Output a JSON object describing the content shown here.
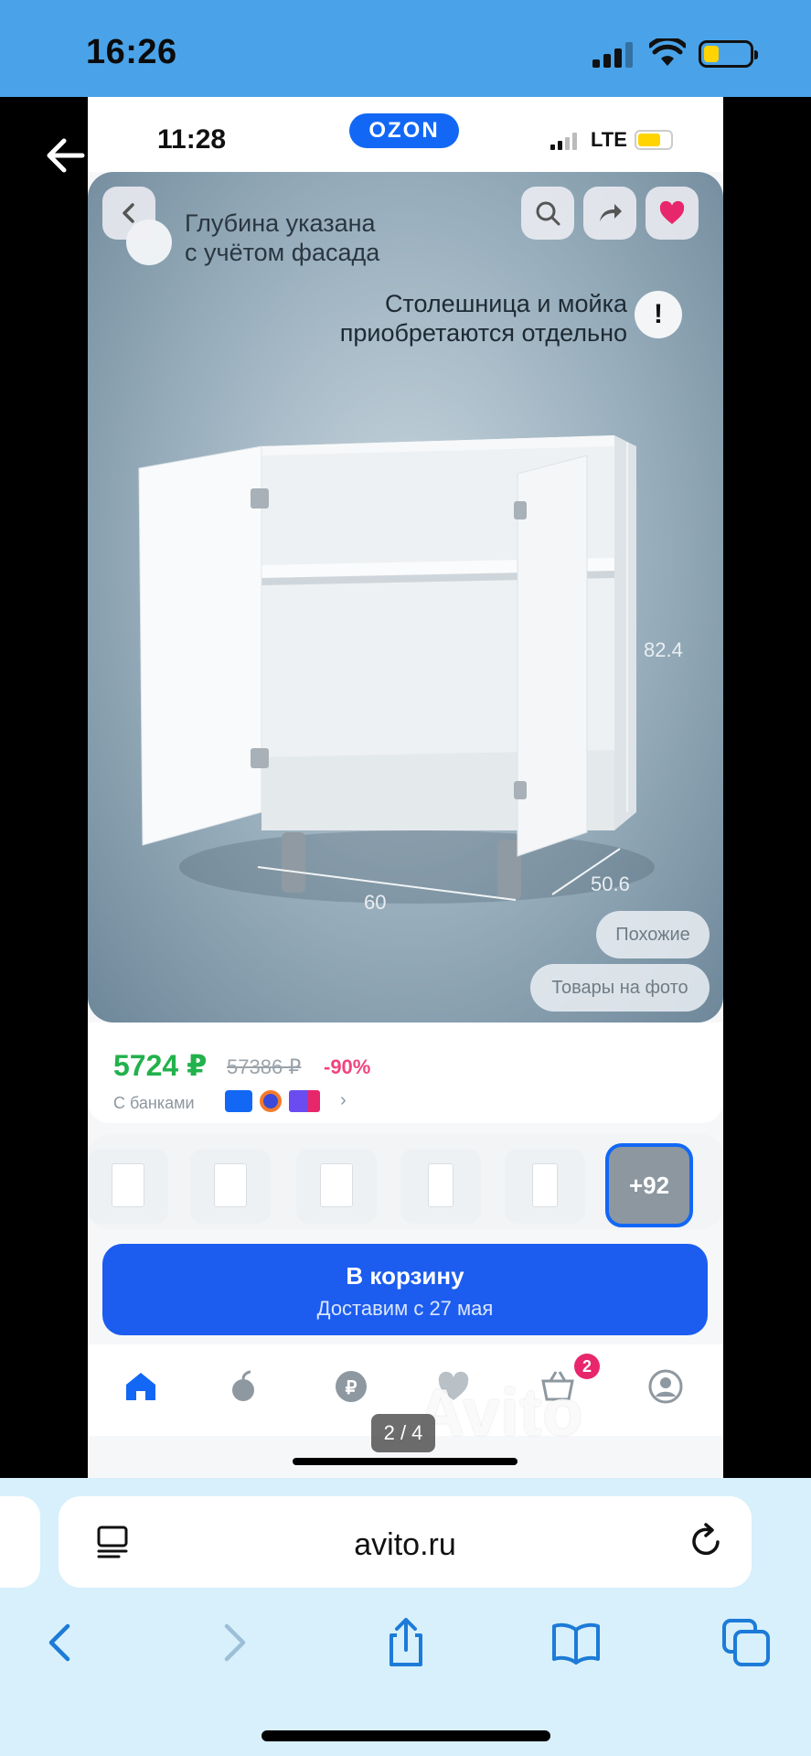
{
  "ios_status": {
    "time": "16:26",
    "icons": [
      "cellular-signal-icon",
      "wifi-icon",
      "battery-low-icon"
    ]
  },
  "viewer": {
    "back_icon": "arrow-left-icon"
  },
  "screenshot": {
    "status": {
      "time": "11:28",
      "network": "LTE",
      "logo": "OZON"
    },
    "product_image": {
      "caption_depth": "Глубина указана\nс учётом фасада",
      "caption_note": "Столешница и мойка\nприобретаются отдельно",
      "dim_height": "82.4",
      "dim_width": "60",
      "dim_depth": "50.6",
      "chip_similar": "Похожие",
      "chip_products": "Товары на фото",
      "icons": [
        "chevron-left-icon",
        "search-icon",
        "share-icon",
        "heart-icon",
        "exclamation-icon"
      ]
    },
    "price": {
      "current": "5724 ₽",
      "old": "57386 ₽",
      "discount": "-90%",
      "banks_label": "С банками",
      "more": "›"
    },
    "thumbnails": {
      "more_label": "+92"
    },
    "cart": {
      "title": "В корзину",
      "subtitle": "Доставим с 27 мая"
    },
    "tabbar": {
      "badge": "2",
      "icons": [
        "home-icon",
        "fresh-icon",
        "ruble-icon",
        "favorites-icon",
        "basket-icon",
        "profile-icon"
      ]
    },
    "watermark": "Avito",
    "page_indicator": "2 / 4"
  },
  "safari": {
    "url": "avito.ru",
    "icons": [
      "reader-mode-icon",
      "reload-icon",
      "back-icon",
      "forward-icon",
      "share-icon",
      "bookmarks-icon",
      "tabs-icon"
    ]
  },
  "colors": {
    "ios_bar": "#4aa3e8",
    "ozon_blue": "#1268f5",
    "price_green": "#22b14c",
    "discount_pink": "#f0457e",
    "cart_blue": "#1c5df0",
    "safari_bg": "#d7f0fb"
  }
}
